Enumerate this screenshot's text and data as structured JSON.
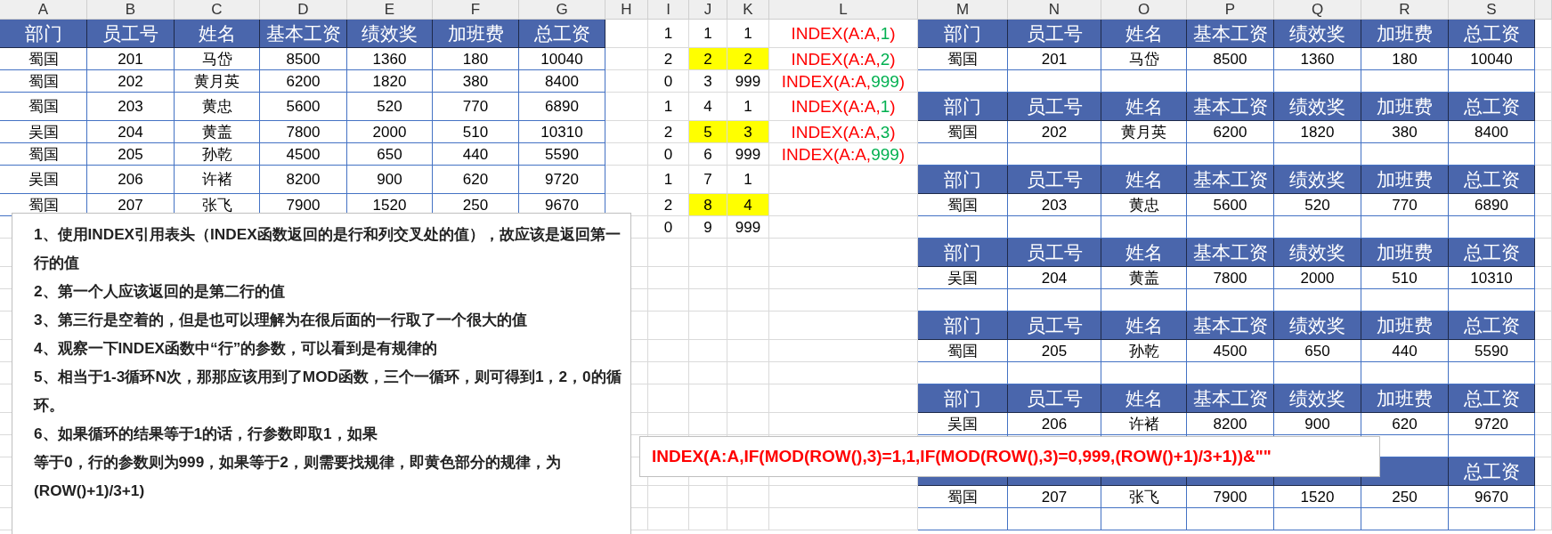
{
  "columns": [
    "A",
    "B",
    "C",
    "D",
    "E",
    "F",
    "G",
    "H",
    "I",
    "J",
    "K",
    "L",
    "M",
    "N",
    "O",
    "P",
    "Q",
    "R",
    "S"
  ],
  "left_table": {
    "header": [
      "部门",
      "员工号",
      "姓名",
      "基本工资",
      "绩效奖",
      "加班费",
      "总工资"
    ],
    "rows": [
      [
        "蜀国",
        "201",
        "马岱",
        "8500",
        "1360",
        "180",
        "10040"
      ],
      [
        "蜀国",
        "202",
        "黄月英",
        "6200",
        "1820",
        "380",
        "8400"
      ],
      [
        "蜀国",
        "203",
        "黄忠",
        "5600",
        "520",
        "770",
        "6890"
      ],
      [
        "吴国",
        "204",
        "黄盖",
        "7800",
        "2000",
        "510",
        "10310"
      ],
      [
        "蜀国",
        "205",
        "孙乾",
        "4500",
        "650",
        "440",
        "5590"
      ],
      [
        "吴国",
        "206",
        "许褚",
        "8200",
        "900",
        "620",
        "9720"
      ],
      [
        "蜀国",
        "207",
        "张飞",
        "7900",
        "1520",
        "250",
        "9670"
      ]
    ]
  },
  "helper": {
    "rows": [
      {
        "i": "1",
        "j": "1",
        "k": "1",
        "highlighted": false,
        "formula": {
          "func": "INDEX(A:A,",
          "arg": "1",
          "close": ")"
        }
      },
      {
        "i": "2",
        "j": "2",
        "k": "2",
        "highlighted": true,
        "formula": {
          "func": "INDEX(A:A,",
          "arg": "2",
          "close": ")"
        }
      },
      {
        "i": "0",
        "j": "3",
        "k": "999",
        "highlighted": false,
        "formula": {
          "func": "INDEX(A:A,",
          "arg": "999",
          "close": ")"
        }
      },
      {
        "i": "1",
        "j": "4",
        "k": "1",
        "highlighted": false,
        "formula": {
          "func": "INDEX(A:A,",
          "arg": "1",
          "close": ")"
        }
      },
      {
        "i": "2",
        "j": "5",
        "k": "3",
        "highlighted": true,
        "formula": {
          "func": "INDEX(A:A,",
          "arg": "3",
          "close": ")"
        }
      },
      {
        "i": "0",
        "j": "6",
        "k": "999",
        "highlighted": false,
        "formula": {
          "func": "INDEX(A:A,",
          "arg": "999",
          "close": ")"
        }
      },
      {
        "i": "1",
        "j": "7",
        "k": "1",
        "highlighted": false
      },
      {
        "i": "2",
        "j": "8",
        "k": "4",
        "highlighted": true
      },
      {
        "i": "0",
        "j": "9",
        "k": "999",
        "highlighted": false
      }
    ]
  },
  "right_table": {
    "groups": [
      {
        "header": [
          "部门",
          "员工号",
          "姓名",
          "基本工资",
          "绩效奖",
          "加班费",
          "总工资"
        ],
        "row": [
          "蜀国",
          "201",
          "马岱",
          "8500",
          "1360",
          "180",
          "10040"
        ]
      },
      {
        "header": [
          "部门",
          "员工号",
          "姓名",
          "基本工资",
          "绩效奖",
          "加班费",
          "总工资"
        ],
        "row": [
          "蜀国",
          "202",
          "黄月英",
          "6200",
          "1820",
          "380",
          "8400"
        ]
      },
      {
        "header": [
          "部门",
          "员工号",
          "姓名",
          "基本工资",
          "绩效奖",
          "加班费",
          "总工资"
        ],
        "row": [
          "蜀国",
          "203",
          "黄忠",
          "5600",
          "520",
          "770",
          "6890"
        ]
      },
      {
        "header": [
          "部门",
          "员工号",
          "姓名",
          "基本工资",
          "绩效奖",
          "加班费",
          "总工资"
        ],
        "row": [
          "吴国",
          "204",
          "黄盖",
          "7800",
          "2000",
          "510",
          "10310"
        ]
      },
      {
        "header": [
          "部门",
          "员工号",
          "姓名",
          "基本工资",
          "绩效奖",
          "加班费",
          "总工资"
        ],
        "row": [
          "蜀国",
          "205",
          "孙乾",
          "4500",
          "650",
          "440",
          "5590"
        ]
      },
      {
        "header": [
          "部门",
          "员工号",
          "姓名",
          "基本工资",
          "绩效奖",
          "加班费",
          "总工资"
        ],
        "row": [
          "吴国",
          "206",
          "许褚",
          "8200",
          "900",
          "620",
          "9720"
        ]
      },
      {
        "header": [
          "总工资"
        ],
        "row": [
          "蜀国",
          "207",
          "张飞",
          "7900",
          "1520",
          "250",
          "9670"
        ]
      }
    ]
  },
  "notes": {
    "paragraphs": [
      "1、使用INDEX引用表头（INDEX函数返回的是行和列交叉处的值），故应该是返回第一行的值",
      "2、第一个人应该返回的是第二行的值",
      "3、第三行是空着的，但是也可以理解为在很后面的一行取了一个很大的值",
      "4、观察一下INDEX函数中“行”的参数，可以看到是有规律的",
      "5、相当于1-3循环N次，那那应该用到了MOD函数，三个一循环，则可得到1，2，0的循环。",
      "6、如果循环的结果等于1的话，行参数即取1，如果",
      "等于0，行的参数则为999，如果等于2，则需要找规律，即黄色部分的规律，为(ROW()+1)/3+1)"
    ]
  },
  "formula_box": {
    "text": "INDEX(A:A,IF(MOD(ROW(),3)=1,1,IF(MOD(ROW(),3)=0,999,(ROW()+1)/3+1))&\"\""
  }
}
